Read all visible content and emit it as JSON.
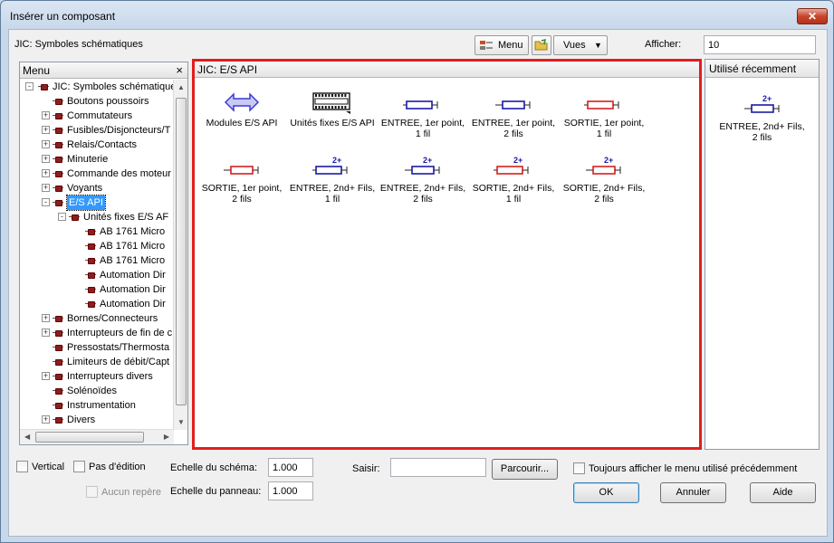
{
  "window": {
    "title": "Insérer un composant",
    "close_glyph": "✕"
  },
  "toolbar": {
    "library_label": "JIC: Symboles schématiques",
    "menu_button_label": "Menu",
    "views_button_label": "Vues",
    "views_arrow": "▼",
    "afficher_label": "Afficher:",
    "afficher_value": "10"
  },
  "menu_panel": {
    "header": "Menu",
    "close_glyph": "×",
    "tree": [
      {
        "label": "JIC: Symboles schématique",
        "expander": "-"
      },
      {
        "label": "Boutons poussoirs",
        "expander": ""
      },
      {
        "label": "Commutateurs",
        "expander": "+"
      },
      {
        "label": "Fusibles/Disjoncteurs/T",
        "expander": "+"
      },
      {
        "label": "Relais/Contacts",
        "expander": "+"
      },
      {
        "label": "Minuterie",
        "expander": "+"
      },
      {
        "label": "Commande des moteur",
        "expander": "+"
      },
      {
        "label": "Voyants",
        "expander": "+"
      },
      {
        "label": "E/S API",
        "expander": "-"
      },
      {
        "label": "Unités fixes E/S AF",
        "expander": "-"
      },
      {
        "label": "AB 1761 Micro",
        "expander": ""
      },
      {
        "label": "AB 1761 Micro",
        "expander": ""
      },
      {
        "label": "AB 1761 Micro",
        "expander": ""
      },
      {
        "label": "Automation Dir",
        "expander": ""
      },
      {
        "label": "Automation Dir",
        "expander": ""
      },
      {
        "label": "Automation Dir",
        "expander": ""
      },
      {
        "label": "Bornes/Connecteurs",
        "expander": "+"
      },
      {
        "label": "Interrupteurs de fin de c",
        "expander": "+"
      },
      {
        "label": "Pressostats/Thermosta",
        "expander": ""
      },
      {
        "label": "Limiteurs de débit/Capt",
        "expander": ""
      },
      {
        "label": "Interrupteurs divers",
        "expander": "+"
      },
      {
        "label": "Solénoïdes",
        "expander": ""
      },
      {
        "label": "Instrumentation",
        "expander": ""
      },
      {
        "label": "Divers",
        "expander": "+"
      }
    ],
    "scroll_up": "▲",
    "scroll_down": "▼",
    "scroll_left": "◀",
    "scroll_right": "▶"
  },
  "center_panel": {
    "header": "JIC: E/S API",
    "components": [
      {
        "line1": "Modules E/S API",
        "line2": "",
        "icon": "double-arrow-icon"
      },
      {
        "line1": "Unités fixes E/S API",
        "line2": "",
        "icon": "terminal-strip-icon"
      },
      {
        "line1": "ENTREE, 1er point,",
        "line2": "1 fil",
        "icon": "input-1wire-icon"
      },
      {
        "line1": "ENTREE, 1er point,",
        "line2": "2 fils",
        "icon": "input-2wire-icon"
      },
      {
        "line1": "SORTIE, 1er point,",
        "line2": "1 fil",
        "icon": "output-1wire-icon"
      },
      {
        "line1": "SORTIE, 1er point,",
        "line2": "2 fils",
        "icon": "output-2wire-icon"
      },
      {
        "line1": "ENTREE, 2nd+ Fils,",
        "line2": "1 fil",
        "icon": "input-2plus-1wire-icon"
      },
      {
        "line1": "ENTREE, 2nd+ Fils,",
        "line2": "2 fils",
        "icon": "input-2plus-2wire-icon"
      },
      {
        "line1": "SORTIE, 2nd+ Fils,",
        "line2": "1 fil",
        "icon": "output-2plus-1wire-icon"
      },
      {
        "line1": "SORTIE, 2nd+ Fils,",
        "line2": "2 fils",
        "icon": "output-2plus-2wire-icon"
      }
    ],
    "badge_text": "2+"
  },
  "recent_panel": {
    "header": "Utilisé récemment",
    "items": [
      {
        "line1": "ENTREE, 2nd+ Fils,",
        "line2": "2 fils",
        "icon": "input-2plus-2wire-icon"
      }
    ]
  },
  "bottom": {
    "vertical_label": "Vertical",
    "pas_edition_label": "Pas d'édition",
    "aucun_repere_label": "Aucun repère",
    "echelle_schema_label": "Echelle du schéma:",
    "echelle_schema_value": "1.000",
    "echelle_panneau_label": "Echelle du panneau:",
    "echelle_panneau_value": "1.000",
    "saisir_label": "Saisir:",
    "saisir_value": "",
    "parcourir_label": "Parcourir...",
    "toujours_label": "Toujours afficher le menu utilisé précédemment",
    "ok_label": "OK",
    "annuler_label": "Annuler",
    "aide_label": "Aide"
  },
  "colors": {
    "highlight_border": "#e31d1d",
    "input_symbol": "#1a1aa8",
    "output_symbol": "#d42020",
    "selection": "#3399ff"
  }
}
